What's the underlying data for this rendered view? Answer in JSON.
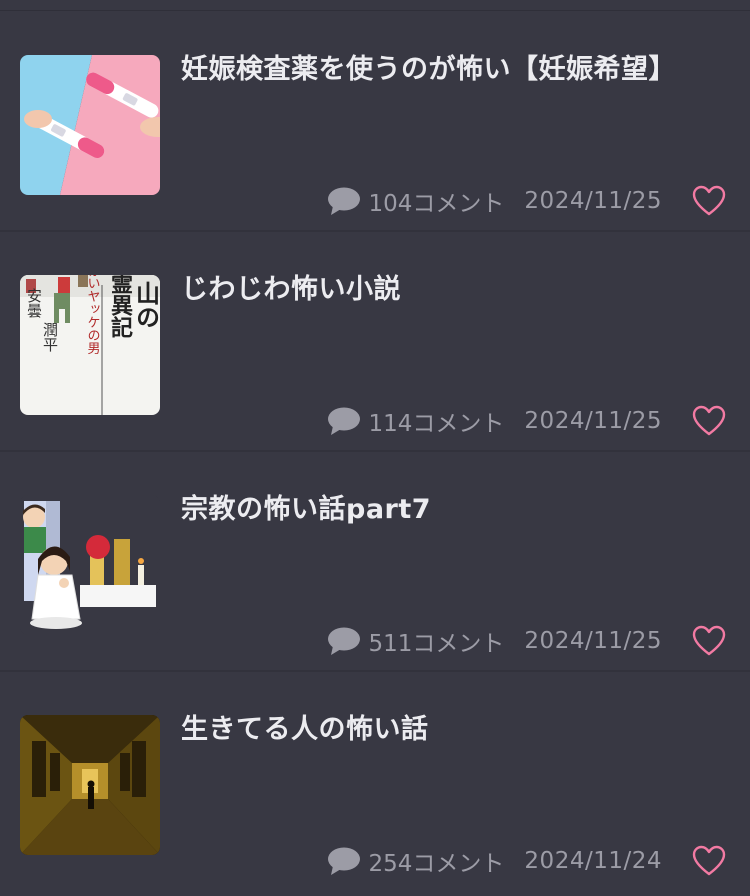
{
  "colors": {
    "background": "#383843",
    "title_text": "#ececf0",
    "meta_text": "#9c9ca6",
    "heart": "#f27aa3"
  },
  "items": [
    {
      "title": "妊娠検査薬を使うのが怖い【妊娠希望】",
      "comments": "104コメント",
      "date": "2024/11/25",
      "thumbnail": "pregnancy-test-image"
    },
    {
      "title": "じわじわ怖い小説",
      "comments": "114コメント",
      "date": "2024/11/25",
      "thumbnail": "book-cover-image",
      "thumb_text": {
        "title": "山の霊異記",
        "subtitle": "赤いヤッケの男",
        "author": "安曇潤平"
      }
    },
    {
      "title": "宗教の怖い話part7",
      "comments": "511コメント",
      "date": "2024/11/25",
      "thumbnail": "praying-girl-illustration"
    },
    {
      "title": "生きてる人の怖い話",
      "comments": "254コメント",
      "date": "2024/11/24",
      "thumbnail": "dark-corridor-photo"
    }
  ]
}
